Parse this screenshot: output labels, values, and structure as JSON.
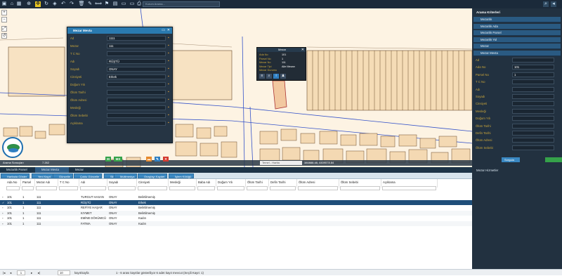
{
  "topbar": {
    "icons": [
      "save-icon",
      "home-icon",
      "table-icon",
      "zoom-in-icon",
      "move-icon",
      "refresh-icon",
      "layers-icon",
      "back-icon",
      "forward-icon",
      "delete-icon",
      "edit-icon",
      "measure-icon",
      "flag-icon",
      "calendar-icon",
      "chat-icon",
      "monitor-icon",
      "print-icon"
    ],
    "search_placeholder": "Kurum Arama...",
    "right_icons": [
      "search-icon",
      "collapse-icon"
    ]
  },
  "dialog": {
    "title": "Mezar Mevta",
    "fields": [
      {
        "label": "Ad",
        "value": "1111"
      },
      {
        "label": "Mezar",
        "value": "111"
      },
      {
        "label": "T C No",
        "value": ""
      },
      {
        "label": "Adı",
        "value": "RÜŞTÜ"
      },
      {
        "label": "Soyadı",
        "value": "ONAY"
      },
      {
        "label": "Cinsiyeti",
        "value": "Erkek"
      },
      {
        "label": "Doğum Yılı",
        "value": ""
      },
      {
        "label": "Ölüm Tarihi",
        "value": ""
      },
      {
        "label": "Ölüm Adresi",
        "value": ""
      },
      {
        "label": "Mesleği",
        "value": ""
      },
      {
        "label": "Ölüm Sebebi",
        "value": ""
      },
      {
        "label": "Açıklama",
        "value": ""
      }
    ],
    "buttons": [
      "M",
      "MX"
    ]
  },
  "popup": {
    "title": "Mezar",
    "rows": [
      {
        "label": "Ada No",
        "value": "101"
      },
      {
        "label": "Parsel No",
        "value": "1"
      },
      {
        "label": "Mezar No",
        "value": "111"
      },
      {
        "label": "Mezar Tipi",
        "value": "Aile Mezarı"
      },
      {
        "label": "Mezar Durumu",
        "value": ""
      }
    ]
  },
  "right_panel": {
    "title": "Arama Kriterleri",
    "items": [
      "Mezarlık",
      "Mezarlık Ada",
      "Mezarlık Parsel",
      "Mezarlık Yol",
      "Mezar",
      "Mezar Mevta"
    ],
    "fields": [
      {
        "label": "Ad",
        "value": ""
      },
      {
        "label": "Ada No",
        "value": "101"
      },
      {
        "label": "Parsel No",
        "value": "1"
      },
      {
        "label": "T C No",
        "value": ""
      },
      {
        "label": "Adı",
        "value": ""
      },
      {
        "label": "Soyadı",
        "value": ""
      },
      {
        "label": "Cinsiyeti",
        "value": ""
      },
      {
        "label": "Mesleği",
        "value": ""
      },
      {
        "label": "Doğum Yılı",
        "value": ""
      },
      {
        "label": "Ölüm Tarihi",
        "value": ""
      },
      {
        "label": "Defin Tarihi",
        "value": ""
      },
      {
        "label": "Ölüm Adresi",
        "value": ""
      },
      {
        "label": "Ölüm Sebebi",
        "value": ""
      }
    ],
    "search_button": "Sorgula",
    "results_title": "Mezar Hizmetler"
  },
  "map": {
    "search_results_tab": "Arama Sonuçları",
    "scale": "7.262",
    "coords": "380888.48, 4409578.84",
    "basemap": "Temel - Harita"
  },
  "tabs": [
    "Mezarlık Parsel",
    "Mezar Mevta",
    "Mezar"
  ],
  "toolbar": [
    "Haritada Göster",
    "Yeni Kayıt",
    "Güncelle",
    "Çoklu Güncelle",
    "Sil",
    "Multimedya",
    "Onaylayı Kaydet",
    "İşlem Kütüğü"
  ],
  "grid": {
    "headers": [
      "Ada No",
      "Parsel No",
      "Mezar Adı",
      "T C No",
      "Adı",
      "Soyadı",
      "Cinsiyeti",
      "Mesleği",
      "Baba Adı",
      "Doğum Yılı",
      "Ölüm Tarihi",
      "Defin Tarihi",
      "Ölüm Adresi",
      "Ölüm Sebebi",
      "Açıklama"
    ],
    "rows": [
      [
        "101",
        "1",
        "111",
        "",
        "TURGUT HASAN",
        "ONAY",
        "Belirtilmemiş",
        "",
        "",
        "",
        "",
        "",
        "",
        "",
        ""
      ],
      [
        "101",
        "1",
        "111",
        "",
        "RÜŞTÜ",
        "ONAY",
        "Erkek",
        "",
        "",
        "",
        "",
        "",
        "",
        "",
        ""
      ],
      [
        "101",
        "1",
        "111",
        "",
        "REFİYE HAŞAR",
        "ONAY",
        "Belirtilmemiş",
        "",
        "",
        "",
        "",
        "",
        "",
        "",
        ""
      ],
      [
        "101",
        "1",
        "111",
        "",
        "KIYMET",
        "ONAY",
        "Belirtilmemiş",
        "",
        "",
        "",
        "",
        "",
        "",
        "",
        ""
      ],
      [
        "101",
        "1",
        "111",
        "",
        "EMİNE DÖKÜMCÜ",
        "ONAY",
        "Kadın",
        "",
        "",
        "",
        "",
        "",
        "",
        "",
        ""
      ],
      [
        "101",
        "1",
        "111",
        "",
        "FATMA",
        "ONAY",
        "Kadın",
        "",
        "",
        "",
        "",
        "",
        "",
        "",
        ""
      ]
    ],
    "selected_index": 1
  },
  "footer": {
    "page": "1",
    "page_size": "10",
    "page_size_label": "kayıt/sayfa",
    "info": "1 - 6 arası kayıtlar gösteriliyor 6 adet kayıt mevcut (Seçili Kayıt: 1)"
  }
}
